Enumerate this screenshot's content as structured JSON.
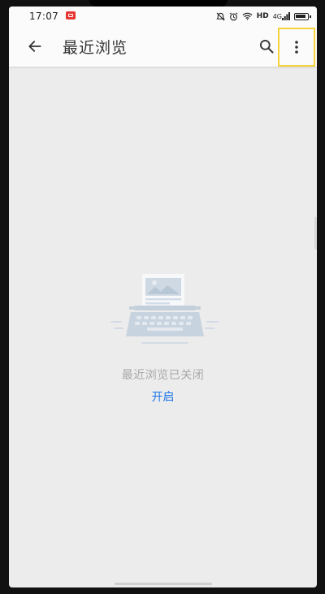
{
  "status_bar": {
    "time": "17:07",
    "network_label": "HD",
    "signal_label": "4G",
    "icons": [
      "recording-icon",
      "alarm-off-icon",
      "alarm-icon",
      "wifi-icon",
      "hd-icon",
      "signal-icon",
      "battery-icon"
    ]
  },
  "app_bar": {
    "title": "最近浏览",
    "back_icon": "arrow-back-icon",
    "search_icon": "search-icon",
    "more_icon": "more-vert-icon"
  },
  "empty_state": {
    "illustration": "typewriter-icon",
    "message": "最近浏览已关闭",
    "action_label": "开启"
  },
  "colors": {
    "link": "#1a73e8",
    "message": "#a8a8a8",
    "title": "#333333",
    "highlight": "#f5d23c",
    "background": "#ececec"
  }
}
